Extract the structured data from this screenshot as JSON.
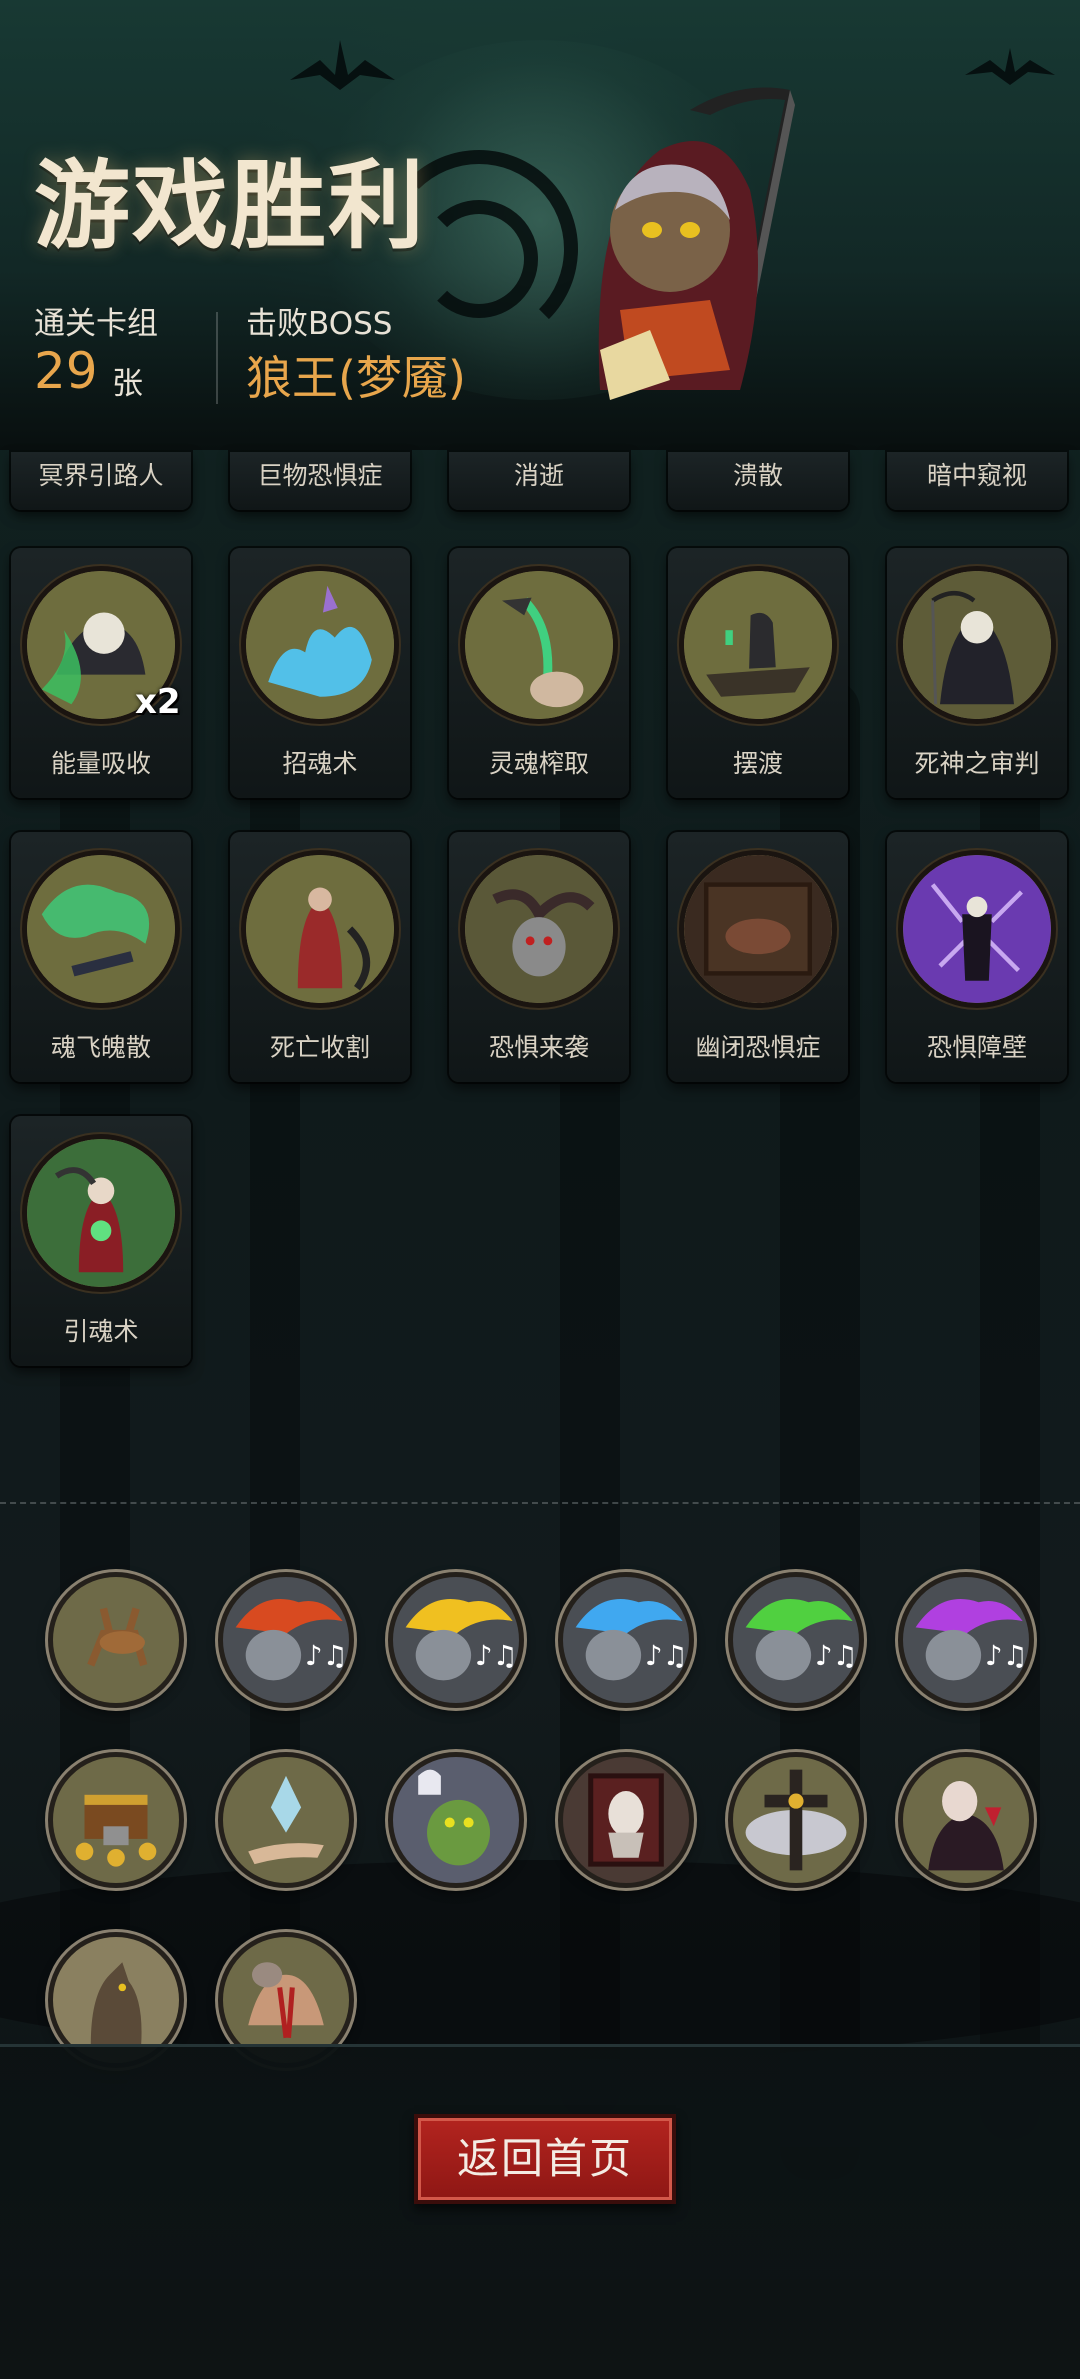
{
  "header": {
    "title": "游戏胜利",
    "deck_label": "通关卡组",
    "deck_count": "29",
    "deck_unit": "张",
    "boss_label": "击败BOSS",
    "boss_name": "狼王(梦魇)"
  },
  "partial_row": [
    "冥界引路人",
    "巨物恐惧症",
    "消逝",
    "溃散",
    "暗中窥视"
  ],
  "cards": [
    {
      "name": "能量吸收",
      "badge": "x2"
    },
    {
      "name": "招魂术"
    },
    {
      "name": "灵魂榨取"
    },
    {
      "name": "摆渡"
    },
    {
      "name": "死神之审判"
    },
    {
      "name": "魂飞魄散"
    },
    {
      "name": "死亡收割"
    },
    {
      "name": "恐惧来袭"
    },
    {
      "name": "幽闭恐惧症"
    },
    {
      "name": "恐惧障壁"
    },
    {
      "name": "引魂术"
    }
  ],
  "relic_icons": [
    "deer-icon",
    "red-flame-skull-icon",
    "yellow-flame-skull-icon",
    "blue-flame-skull-icon",
    "green-flame-skull-icon",
    "purple-flame-skull-icon",
    "treasure-chest-icon",
    "crystal-hand-icon",
    "ghost-monster-icon",
    "coffin-icon",
    "golden-cross-icon",
    "vampire-icon",
    "gargoyle-icon",
    "bloody-fist-icon"
  ],
  "return_button": "返回首页",
  "colors": {
    "accent": "#e8a64c",
    "button": "#a31e1a",
    "title": "#f2e6cf"
  }
}
